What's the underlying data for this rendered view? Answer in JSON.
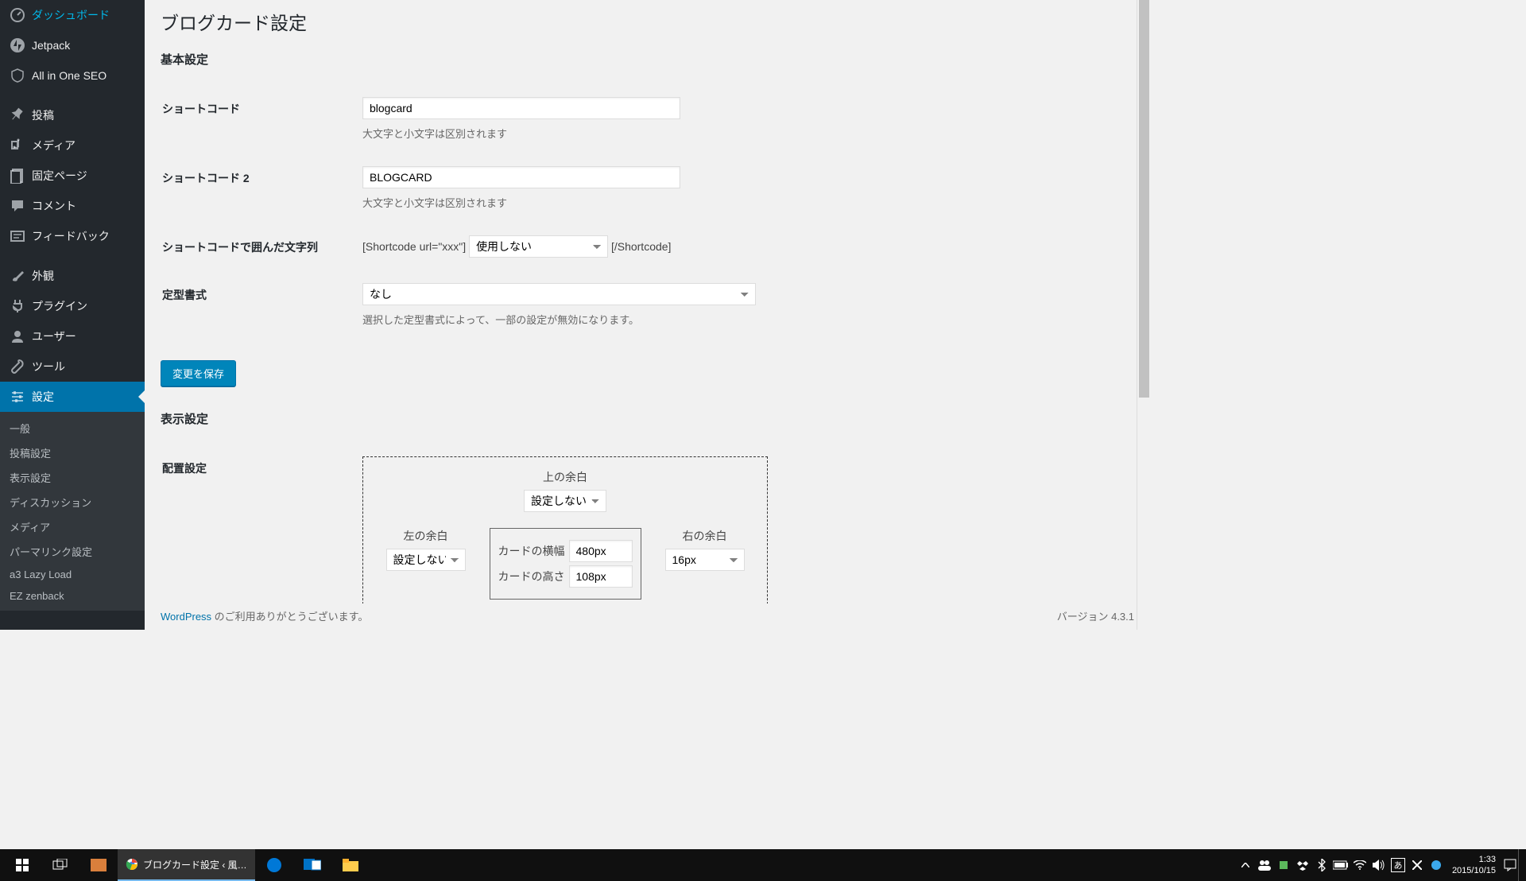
{
  "page": {
    "title": "ブログカード設定"
  },
  "sidebar": {
    "items": [
      {
        "label": "ダッシュボード",
        "icon": "dashboard"
      },
      {
        "label": "Jetpack",
        "icon": "jetpack"
      },
      {
        "label": "All in One SEO",
        "icon": "shield"
      }
    ],
    "items2": [
      {
        "label": "投稿",
        "icon": "pin"
      },
      {
        "label": "メディア",
        "icon": "media"
      },
      {
        "label": "固定ページ",
        "icon": "page"
      },
      {
        "label": "コメント",
        "icon": "comment"
      },
      {
        "label": "フィードバック",
        "icon": "feedback"
      }
    ],
    "items3": [
      {
        "label": "外観",
        "icon": "brush"
      },
      {
        "label": "プラグイン",
        "icon": "plug"
      },
      {
        "label": "ユーザー",
        "icon": "user"
      },
      {
        "label": "ツール",
        "icon": "wrench"
      },
      {
        "label": "設定",
        "icon": "settings",
        "active": true
      }
    ],
    "submenu": [
      "一般",
      "投稿設定",
      "表示設定",
      "ディスカッション",
      "メディア",
      "パーマリンク設定",
      "a3 Lazy Load",
      "EZ zenback"
    ]
  },
  "sections": {
    "basic": "基本設定",
    "display": "表示設定"
  },
  "form": {
    "shortcode": {
      "label": "ショートコード",
      "value": "blogcard",
      "desc": "大文字と小文字は区別されます"
    },
    "shortcode2": {
      "label": "ショートコード 2",
      "value": "BLOGCARD",
      "desc": "大文字と小文字は区別されます"
    },
    "enclosed": {
      "label": "ショートコードで囲んだ文字列",
      "prefix": "[Shortcode url=\"xxx\"]",
      "value": "使用しない",
      "suffix": "[/Shortcode]"
    },
    "template": {
      "label": "定型書式",
      "value": "なし",
      "desc": "選択した定型書式によって、一部の設定が無効になります。"
    },
    "save": "変更を保存",
    "layout": {
      "label": "配置設定",
      "top": "上の余白",
      "top_value": "設定しない",
      "left": "左の余白",
      "left_value": "設定しない",
      "right": "右の余白",
      "right_value": "16px",
      "width_label": "カードの横幅",
      "width_value": "480px",
      "height_label": "カードの高さ",
      "height_value": "108px"
    }
  },
  "footer": {
    "wp": "WordPress",
    "thanks": " のご利用ありがとうございます。",
    "version": "バージョン 4.3.1"
  },
  "taskbar": {
    "app": "ブログカード設定 ‹ 風…",
    "time": "1:33",
    "date": "2015/10/15"
  }
}
